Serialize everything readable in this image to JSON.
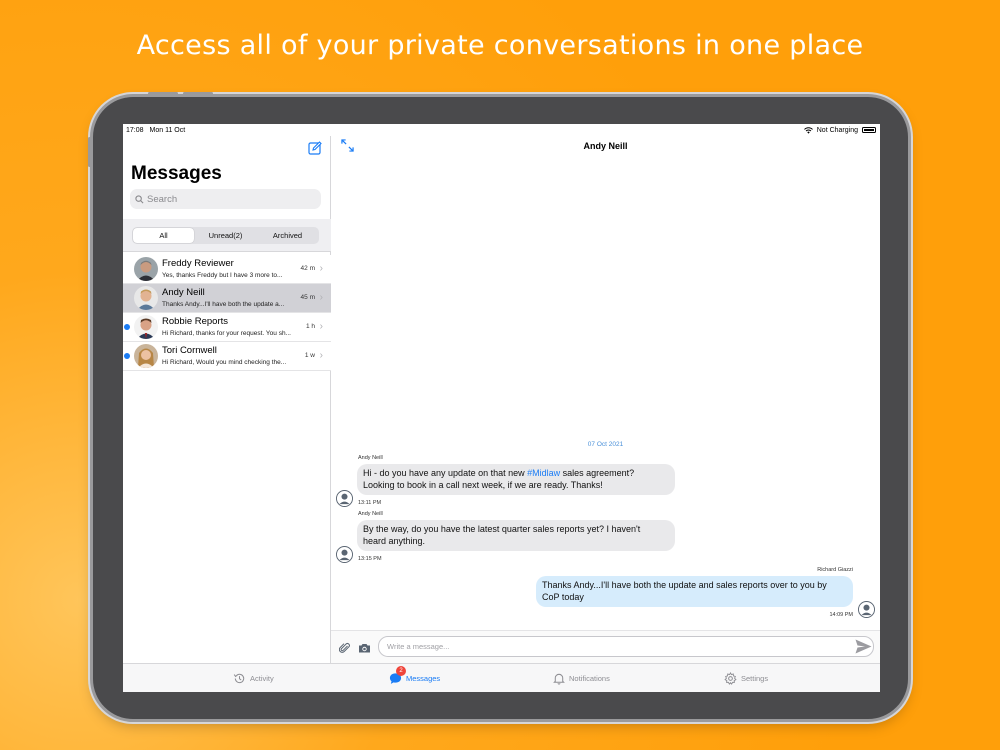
{
  "headline": "Access all of your private conversations in one place",
  "status": {
    "time": "17:08",
    "date": "Mon 11 Oct",
    "charging": "Not Charging"
  },
  "sidebar": {
    "title": "Messages",
    "search_placeholder": "Search",
    "filters": [
      "All",
      "Unread(2)",
      "Archived"
    ],
    "active_filter": "All",
    "conversations": [
      {
        "name": "Freddy Reviewer",
        "preview": "Yes, thanks Freddy but I have 3 more to...",
        "time": "42 m",
        "unread": false,
        "selected": false
      },
      {
        "name": "Andy Neill",
        "preview": "Thanks Andy...I'll have both the update a...",
        "time": "45 m",
        "unread": false,
        "selected": true
      },
      {
        "name": "Robbie Reports",
        "preview": "Hi Richard, thanks for your request. You sh...",
        "time": "1 h",
        "unread": true,
        "selected": false
      },
      {
        "name": "Tori Cornwell",
        "preview": "Hi Richard, Would you mind checking the...",
        "time": "1 w",
        "unread": true,
        "selected": false
      }
    ]
  },
  "chat": {
    "title": "Andy Neill",
    "date_separator": "07 Oct 2021",
    "messages": [
      {
        "sender": "Andy Neill",
        "line1_before": "Hi - do you have any update on that new ",
        "hashtag": "#Midlaw",
        "line1_after": " sales agreement?",
        "line2": "Looking to book in a call next week, if we are ready. Thanks!",
        "time": "13:11 PM"
      },
      {
        "sender": "Andy Neill",
        "line1": "By the way, do you have the latest quarter sales reports yet? I haven't",
        "line2": "heard anything.",
        "time": "13:15 PM"
      },
      {
        "sender": "Richard Giazzi",
        "line1": "Thanks Andy...I'll have both the update and sales reports over to you by",
        "line2": "CoP today",
        "time": "14:09 PM"
      }
    ],
    "input_placeholder": "Write a message..."
  },
  "tabbar": {
    "tabs": [
      {
        "label": "Activity",
        "icon": "history-icon"
      },
      {
        "label": "Messages",
        "icon": "chat-bubble-icon",
        "badge": "2"
      },
      {
        "label": "Notifications",
        "icon": "bell-icon"
      },
      {
        "label": "Settings",
        "icon": "gear-icon"
      }
    ],
    "active": "Messages"
  },
  "colors": {
    "background": "#ff9f0a",
    "accent": "#1a7cf5",
    "badge": "#f0443a",
    "outgoing_bubble": "#d6ecfc",
    "incoming_bubble": "#e9e9eb"
  }
}
